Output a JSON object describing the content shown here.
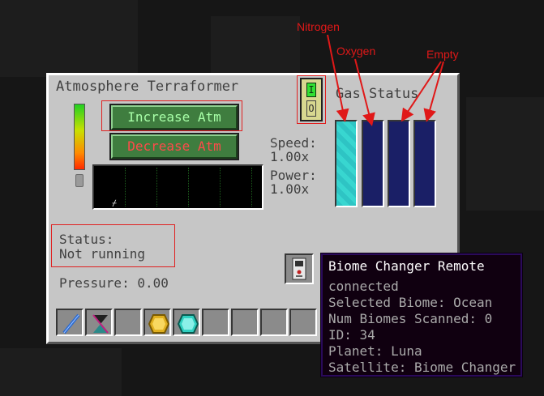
{
  "window": {
    "title": "Atmosphere Terraformer",
    "gas_status_label": "Gas Status"
  },
  "buttons": {
    "increase_atm": "Increase Atm",
    "decrease_atm": "Decrease Atm"
  },
  "toggle": {
    "on_glyph": "I",
    "off_glyph": "O"
  },
  "stats": {
    "speed_label": "Speed:",
    "speed_value": "1.00x",
    "power_label": "Power:",
    "power_value": "1.00x"
  },
  "status": {
    "label": "Status:",
    "value": "Not running"
  },
  "pressure": {
    "text": "Pressure: 0.00"
  },
  "tanks": [
    {
      "fluid": "nitrogen",
      "color": "#2ec4c4"
    },
    {
      "fluid": "oxygen",
      "color": "#1a1f66"
    },
    {
      "fluid": "empty",
      "color": "#1a1f66"
    },
    {
      "fluid": "empty",
      "color": "#1a1f66"
    }
  ],
  "inventory": [
    {
      "item": "wand-icon"
    },
    {
      "item": "hourglass-icon"
    },
    {
      "item": "empty"
    },
    {
      "item": "gold-ore-icon"
    },
    {
      "item": "diamond-icon"
    },
    {
      "item": "empty"
    },
    {
      "item": "empty"
    },
    {
      "item": "empty"
    },
    {
      "item": "empty"
    }
  ],
  "tooltip": {
    "title": "Biome Changer Remote",
    "lines": [
      "connected",
      "Selected Biome: Ocean",
      "Num Biomes Scanned: 0",
      "ID: 34",
      "Planet: Luna",
      "Satellite: Biome Changer"
    ]
  },
  "annotations": {
    "nitrogen": "Nitrogen",
    "oxygen": "Oxygen",
    "empty": "Empty",
    "color": "#e01818"
  },
  "colors": {
    "panel": "#c6c6c6",
    "increase_text": "#a8ffa8",
    "decrease_text": "#ff4a4a",
    "tooltip_bg": "#100010"
  }
}
